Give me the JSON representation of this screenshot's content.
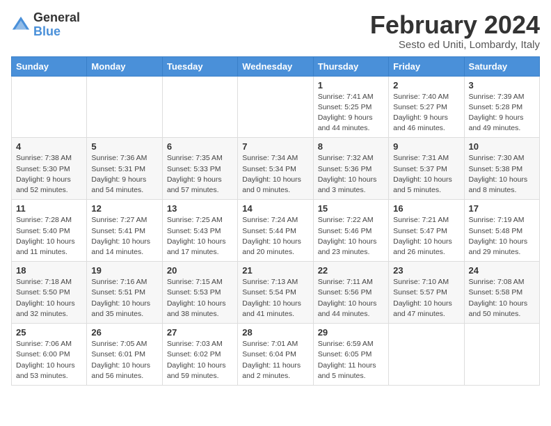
{
  "logo": {
    "general": "General",
    "blue": "Blue"
  },
  "title": "February 2024",
  "location": "Sesto ed Uniti, Lombardy, Italy",
  "days_of_week": [
    "Sunday",
    "Monday",
    "Tuesday",
    "Wednesday",
    "Thursday",
    "Friday",
    "Saturday"
  ],
  "weeks": [
    [
      {
        "day": "",
        "info": ""
      },
      {
        "day": "",
        "info": ""
      },
      {
        "day": "",
        "info": ""
      },
      {
        "day": "",
        "info": ""
      },
      {
        "day": "1",
        "info": "Sunrise: 7:41 AM\nSunset: 5:25 PM\nDaylight: 9 hours\nand 44 minutes."
      },
      {
        "day": "2",
        "info": "Sunrise: 7:40 AM\nSunset: 5:27 PM\nDaylight: 9 hours\nand 46 minutes."
      },
      {
        "day": "3",
        "info": "Sunrise: 7:39 AM\nSunset: 5:28 PM\nDaylight: 9 hours\nand 49 minutes."
      }
    ],
    [
      {
        "day": "4",
        "info": "Sunrise: 7:38 AM\nSunset: 5:30 PM\nDaylight: 9 hours\nand 52 minutes."
      },
      {
        "day": "5",
        "info": "Sunrise: 7:36 AM\nSunset: 5:31 PM\nDaylight: 9 hours\nand 54 minutes."
      },
      {
        "day": "6",
        "info": "Sunrise: 7:35 AM\nSunset: 5:33 PM\nDaylight: 9 hours\nand 57 minutes."
      },
      {
        "day": "7",
        "info": "Sunrise: 7:34 AM\nSunset: 5:34 PM\nDaylight: 10 hours\nand 0 minutes."
      },
      {
        "day": "8",
        "info": "Sunrise: 7:32 AM\nSunset: 5:36 PM\nDaylight: 10 hours\nand 3 minutes."
      },
      {
        "day": "9",
        "info": "Sunrise: 7:31 AM\nSunset: 5:37 PM\nDaylight: 10 hours\nand 5 minutes."
      },
      {
        "day": "10",
        "info": "Sunrise: 7:30 AM\nSunset: 5:38 PM\nDaylight: 10 hours\nand 8 minutes."
      }
    ],
    [
      {
        "day": "11",
        "info": "Sunrise: 7:28 AM\nSunset: 5:40 PM\nDaylight: 10 hours\nand 11 minutes."
      },
      {
        "day": "12",
        "info": "Sunrise: 7:27 AM\nSunset: 5:41 PM\nDaylight: 10 hours\nand 14 minutes."
      },
      {
        "day": "13",
        "info": "Sunrise: 7:25 AM\nSunset: 5:43 PM\nDaylight: 10 hours\nand 17 minutes."
      },
      {
        "day": "14",
        "info": "Sunrise: 7:24 AM\nSunset: 5:44 PM\nDaylight: 10 hours\nand 20 minutes."
      },
      {
        "day": "15",
        "info": "Sunrise: 7:22 AM\nSunset: 5:46 PM\nDaylight: 10 hours\nand 23 minutes."
      },
      {
        "day": "16",
        "info": "Sunrise: 7:21 AM\nSunset: 5:47 PM\nDaylight: 10 hours\nand 26 minutes."
      },
      {
        "day": "17",
        "info": "Sunrise: 7:19 AM\nSunset: 5:48 PM\nDaylight: 10 hours\nand 29 minutes."
      }
    ],
    [
      {
        "day": "18",
        "info": "Sunrise: 7:18 AM\nSunset: 5:50 PM\nDaylight: 10 hours\nand 32 minutes."
      },
      {
        "day": "19",
        "info": "Sunrise: 7:16 AM\nSunset: 5:51 PM\nDaylight: 10 hours\nand 35 minutes."
      },
      {
        "day": "20",
        "info": "Sunrise: 7:15 AM\nSunset: 5:53 PM\nDaylight: 10 hours\nand 38 minutes."
      },
      {
        "day": "21",
        "info": "Sunrise: 7:13 AM\nSunset: 5:54 PM\nDaylight: 10 hours\nand 41 minutes."
      },
      {
        "day": "22",
        "info": "Sunrise: 7:11 AM\nSunset: 5:56 PM\nDaylight: 10 hours\nand 44 minutes."
      },
      {
        "day": "23",
        "info": "Sunrise: 7:10 AM\nSunset: 5:57 PM\nDaylight: 10 hours\nand 47 minutes."
      },
      {
        "day": "24",
        "info": "Sunrise: 7:08 AM\nSunset: 5:58 PM\nDaylight: 10 hours\nand 50 minutes."
      }
    ],
    [
      {
        "day": "25",
        "info": "Sunrise: 7:06 AM\nSunset: 6:00 PM\nDaylight: 10 hours\nand 53 minutes."
      },
      {
        "day": "26",
        "info": "Sunrise: 7:05 AM\nSunset: 6:01 PM\nDaylight: 10 hours\nand 56 minutes."
      },
      {
        "day": "27",
        "info": "Sunrise: 7:03 AM\nSunset: 6:02 PM\nDaylight: 10 hours\nand 59 minutes."
      },
      {
        "day": "28",
        "info": "Sunrise: 7:01 AM\nSunset: 6:04 PM\nDaylight: 11 hours\nand 2 minutes."
      },
      {
        "day": "29",
        "info": "Sunrise: 6:59 AM\nSunset: 6:05 PM\nDaylight: 11 hours\nand 5 minutes."
      },
      {
        "day": "",
        "info": ""
      },
      {
        "day": "",
        "info": ""
      }
    ]
  ]
}
